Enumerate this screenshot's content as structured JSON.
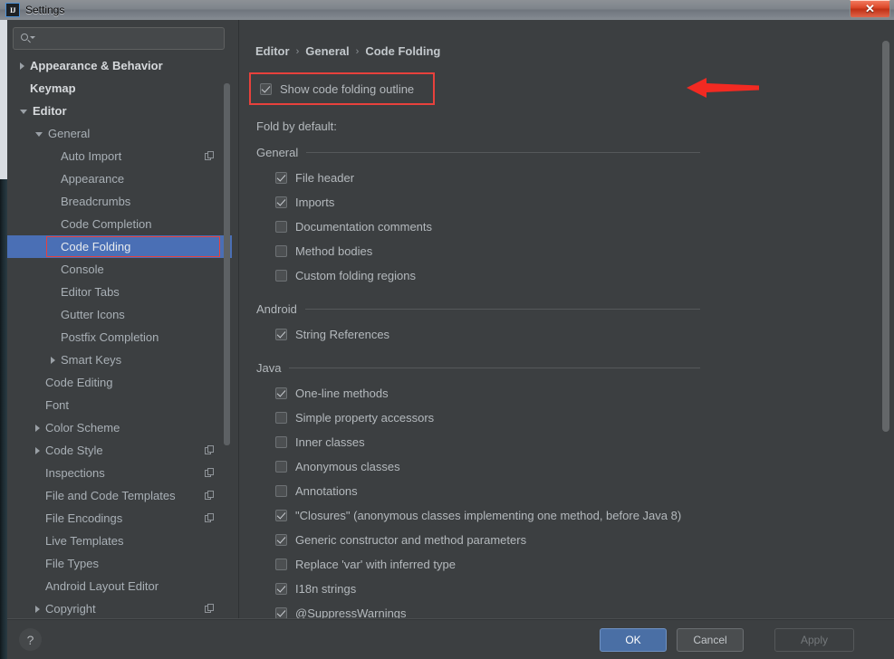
{
  "window": {
    "title": "Settings",
    "logo_text": "IJ",
    "close_label": "✕"
  },
  "sidebar": {
    "search": {
      "value": "",
      "placeholder": ""
    },
    "items": [
      {
        "label": "Appearance & Behavior",
        "level": 0,
        "arrow": "right",
        "bold": true,
        "selected": false,
        "copy": false
      },
      {
        "label": "Keymap",
        "level": 0,
        "arrow": "none",
        "bold": true,
        "selected": false,
        "copy": false
      },
      {
        "label": "Editor",
        "level": 0,
        "arrow": "down",
        "bold": true,
        "selected": false,
        "copy": false
      },
      {
        "label": "General",
        "level": 1,
        "arrow": "down",
        "bold": false,
        "selected": false,
        "copy": false
      },
      {
        "label": "Auto Import",
        "level": 2,
        "arrow": "none",
        "bold": false,
        "selected": false,
        "copy": true
      },
      {
        "label": "Appearance",
        "level": 2,
        "arrow": "none",
        "bold": false,
        "selected": false,
        "copy": false
      },
      {
        "label": "Breadcrumbs",
        "level": 2,
        "arrow": "none",
        "bold": false,
        "selected": false,
        "copy": false
      },
      {
        "label": "Code Completion",
        "level": 2,
        "arrow": "none",
        "bold": false,
        "selected": false,
        "copy": false
      },
      {
        "label": "Code Folding",
        "level": 2,
        "arrow": "none",
        "bold": false,
        "selected": true,
        "copy": false
      },
      {
        "label": "Console",
        "level": 2,
        "arrow": "none",
        "bold": false,
        "selected": false,
        "copy": false
      },
      {
        "label": "Editor Tabs",
        "level": 2,
        "arrow": "none",
        "bold": false,
        "selected": false,
        "copy": false
      },
      {
        "label": "Gutter Icons",
        "level": 2,
        "arrow": "none",
        "bold": false,
        "selected": false,
        "copy": false
      },
      {
        "label": "Postfix Completion",
        "level": 2,
        "arrow": "none",
        "bold": false,
        "selected": false,
        "copy": false
      },
      {
        "label": "Smart Keys",
        "level": 2,
        "arrow": "right",
        "bold": false,
        "selected": false,
        "copy": false
      },
      {
        "label": "Code Editing",
        "level": 1,
        "arrow": "none",
        "bold": false,
        "selected": false,
        "copy": false
      },
      {
        "label": "Font",
        "level": 1,
        "arrow": "none",
        "bold": false,
        "selected": false,
        "copy": false
      },
      {
        "label": "Color Scheme",
        "level": 1,
        "arrow": "right",
        "bold": false,
        "selected": false,
        "copy": false
      },
      {
        "label": "Code Style",
        "level": 1,
        "arrow": "right",
        "bold": false,
        "selected": false,
        "copy": true
      },
      {
        "label": "Inspections",
        "level": 1,
        "arrow": "none",
        "bold": false,
        "selected": false,
        "copy": true
      },
      {
        "label": "File and Code Templates",
        "level": 1,
        "arrow": "none",
        "bold": false,
        "selected": false,
        "copy": true
      },
      {
        "label": "File Encodings",
        "level": 1,
        "arrow": "none",
        "bold": false,
        "selected": false,
        "copy": true
      },
      {
        "label": "Live Templates",
        "level": 1,
        "arrow": "none",
        "bold": false,
        "selected": false,
        "copy": false
      },
      {
        "label": "File Types",
        "level": 1,
        "arrow": "none",
        "bold": false,
        "selected": false,
        "copy": false
      },
      {
        "label": "Android Layout Editor",
        "level": 1,
        "arrow": "none",
        "bold": false,
        "selected": false,
        "copy": false
      },
      {
        "label": "Copyright",
        "level": 1,
        "arrow": "right",
        "bold": false,
        "selected": false,
        "copy": true
      }
    ]
  },
  "main": {
    "breadcrumb": [
      "Editor",
      "General",
      "Code Folding"
    ],
    "breadcrumb_separator": "›",
    "show_outline": {
      "label": "Show code folding outline",
      "checked": true
    },
    "fold_by_default_label": "Fold by default:",
    "sections": [
      {
        "title": "General",
        "items": [
          {
            "label": "File header",
            "checked": true
          },
          {
            "label": "Imports",
            "checked": true
          },
          {
            "label": "Documentation comments",
            "checked": false
          },
          {
            "label": "Method bodies",
            "checked": false
          },
          {
            "label": "Custom folding regions",
            "checked": false
          }
        ]
      },
      {
        "title": "Android",
        "items": [
          {
            "label": "String References",
            "checked": true
          }
        ]
      },
      {
        "title": "Java",
        "items": [
          {
            "label": "One-line methods",
            "checked": true
          },
          {
            "label": "Simple property accessors",
            "checked": false
          },
          {
            "label": "Inner classes",
            "checked": false
          },
          {
            "label": "Anonymous classes",
            "checked": false
          },
          {
            "label": "Annotations",
            "checked": false
          },
          {
            "label": "\"Closures\" (anonymous classes implementing one method, before Java 8)",
            "checked": true
          },
          {
            "label": "Generic constructor and method parameters",
            "checked": true
          },
          {
            "label": "Replace 'var' with inferred type",
            "checked": false
          },
          {
            "label": "I18n strings",
            "checked": true
          },
          {
            "label": "@SuppressWarnings",
            "checked": true
          }
        ]
      }
    ]
  },
  "footer": {
    "help_label": "?",
    "ok_label": "OK",
    "cancel_label": "Cancel",
    "apply_label": "Apply"
  },
  "colors": {
    "accent": "#4a6fb5",
    "annotation_red": "#e8413c",
    "panel_bg": "#3c3f41",
    "text": "#b4b9bd"
  }
}
